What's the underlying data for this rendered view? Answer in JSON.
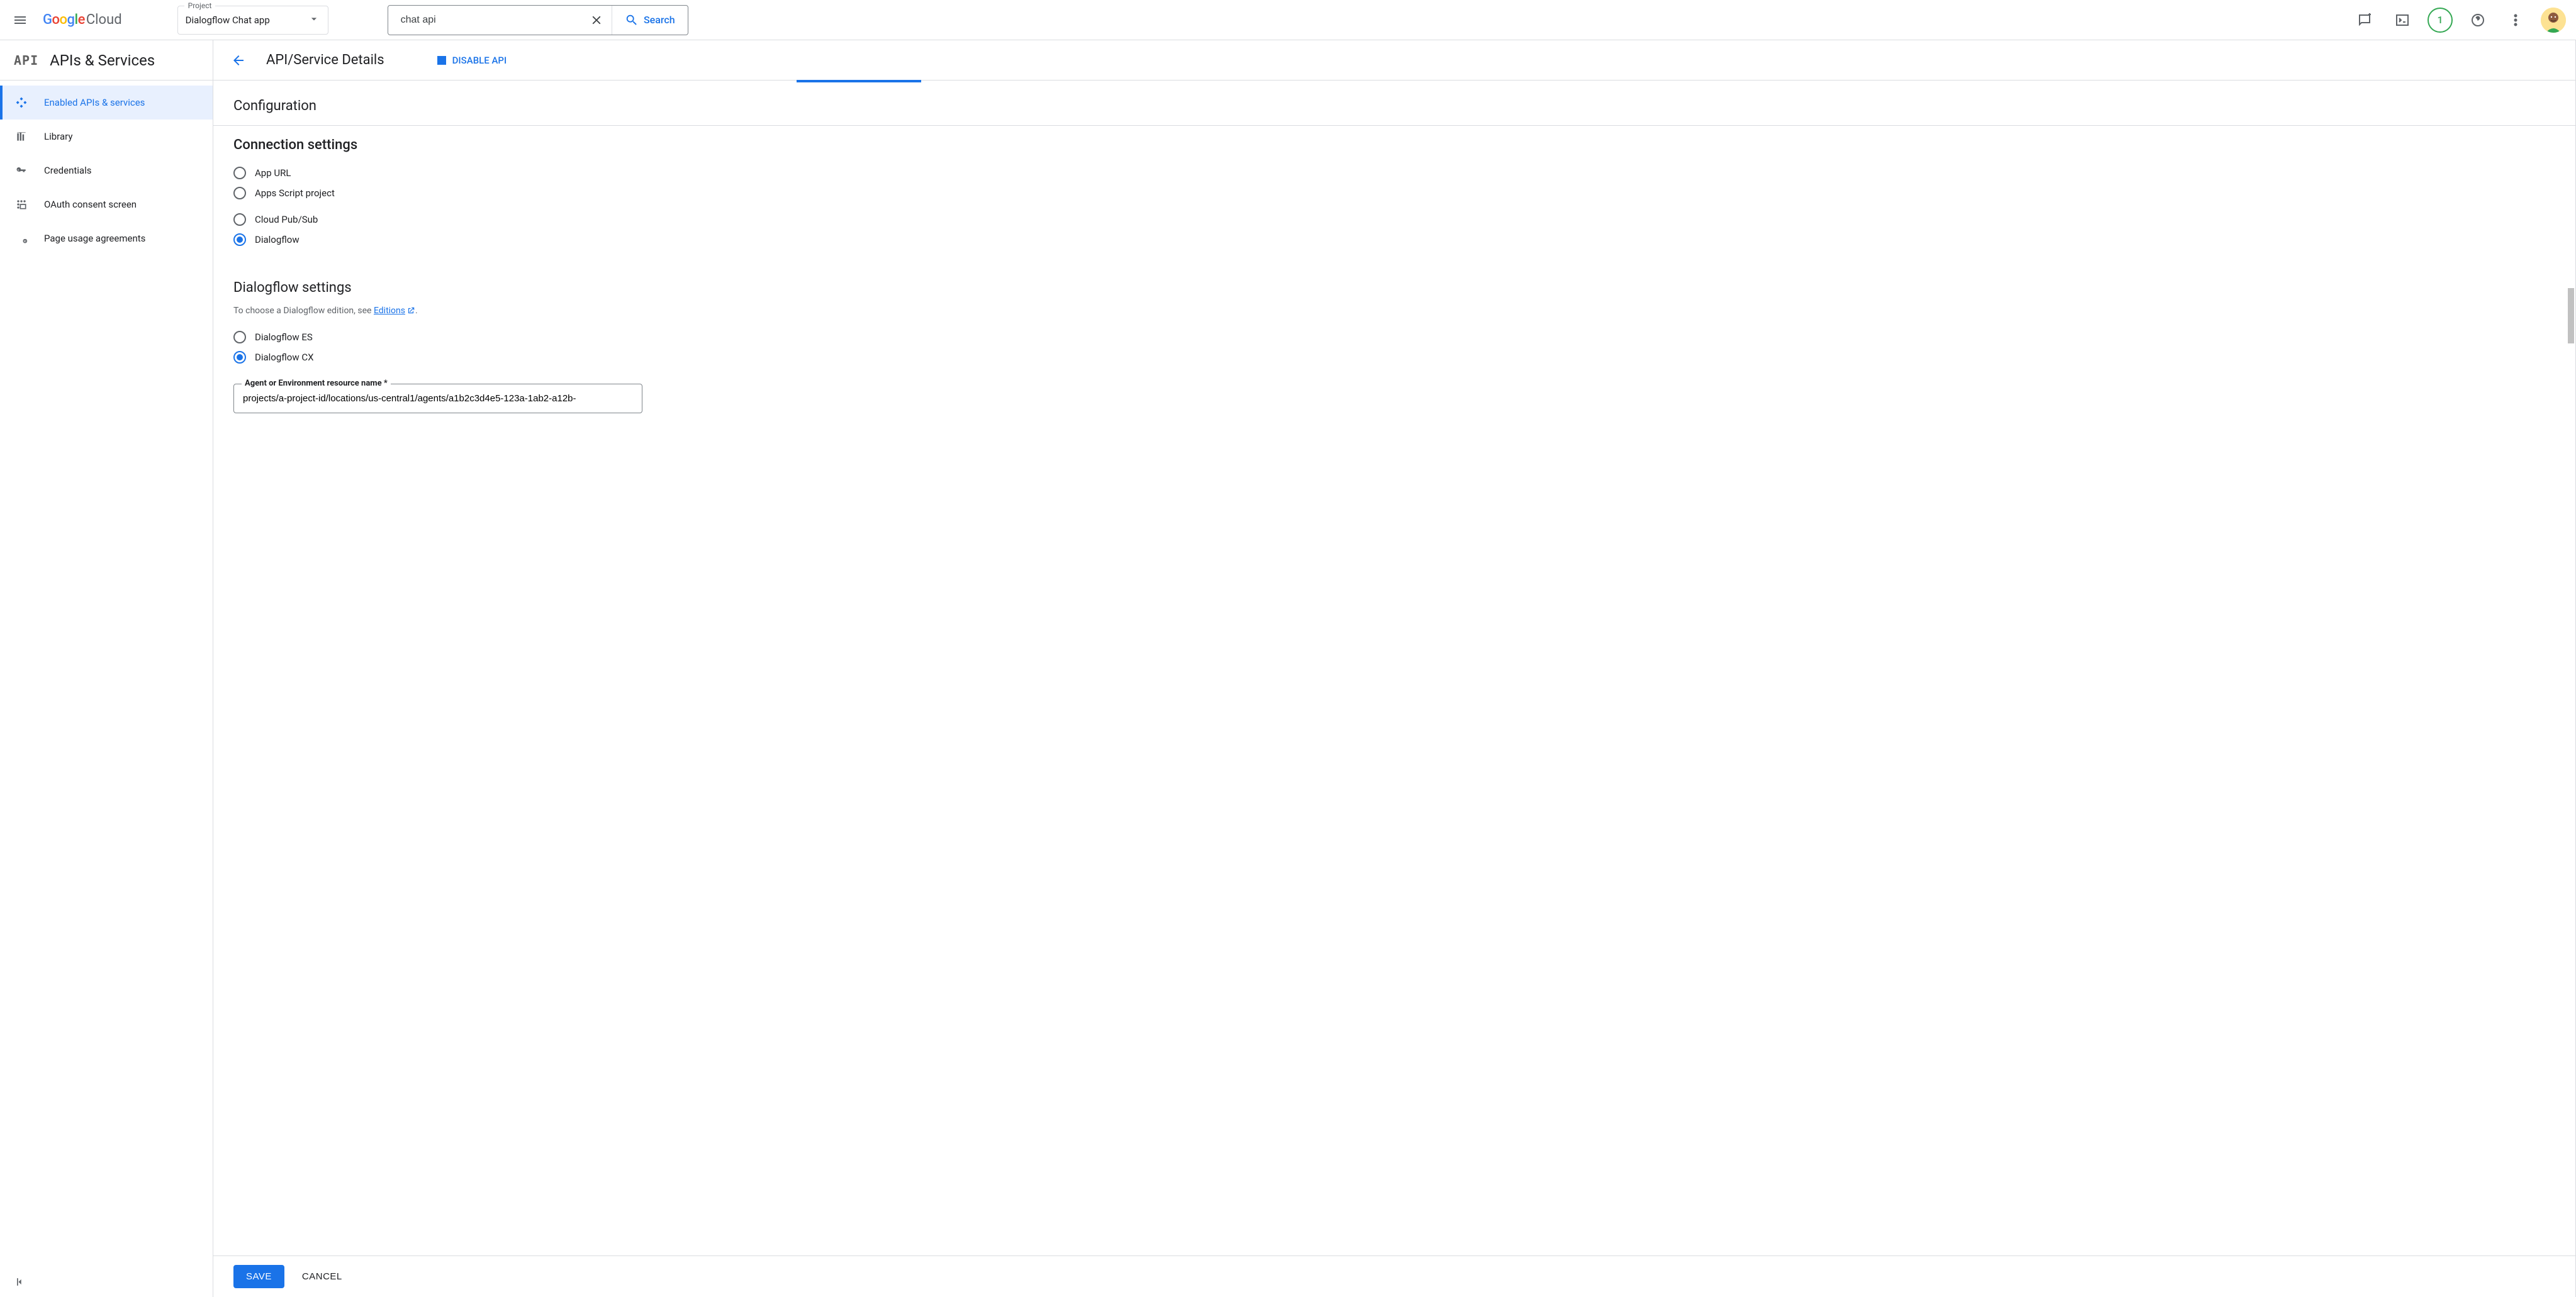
{
  "header": {
    "logo_cloud": "Cloud",
    "project_label": "Project",
    "project_value": "Dialogflow Chat app",
    "search_value": "chat api",
    "search_button_label": "Search",
    "gift_count": "1"
  },
  "sidebar": {
    "product_icon_text": "API",
    "title": "APIs & Services",
    "items": [
      {
        "label": "Enabled APIs & services",
        "active": true,
        "icon": "diamond"
      },
      {
        "label": "Library",
        "active": false,
        "icon": "library"
      },
      {
        "label": "Credentials",
        "active": false,
        "icon": "key"
      },
      {
        "label": "OAuth consent screen",
        "active": false,
        "icon": "consent"
      },
      {
        "label": "Page usage agreements",
        "active": false,
        "icon": "agreement"
      }
    ]
  },
  "page": {
    "title": "API/Service Details",
    "disable_label": "DISABLE API",
    "section_title": "Configuration",
    "connection": {
      "title": "Connection settings",
      "options": {
        "app_url": "App URL",
        "apps_script": "Apps Script project",
        "pubsub": "Cloud Pub/Sub",
        "dialogflow": "Dialogflow"
      },
      "selected": "dialogflow"
    },
    "dialogflow": {
      "title": "Dialogflow settings",
      "help_prefix": "To choose a Dialogflow edition, see ",
      "help_link": "Editions",
      "help_suffix": ".",
      "options": {
        "es": "Dialogflow ES",
        "cx": "Dialogflow CX"
      },
      "selected": "cx",
      "resource_label": "Agent or Environment resource name *",
      "resource_value": "projects/a-project-id/locations/us-central1/agents/a1b2c3d4e5-123a-1ab2-a12b-"
    },
    "save_label": "SAVE",
    "cancel_label": "CANCEL"
  }
}
